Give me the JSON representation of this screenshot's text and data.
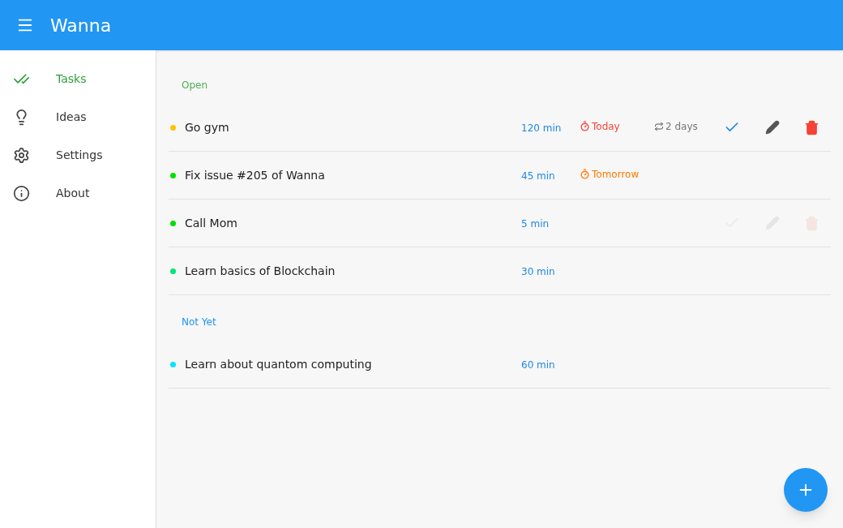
{
  "app_bar": {
    "title": "Wanna"
  },
  "sidebar": {
    "items": [
      {
        "label": "Tasks",
        "selected": true
      },
      {
        "label": "Ideas",
        "selected": false
      },
      {
        "label": "Settings",
        "selected": false
      },
      {
        "label": "About",
        "selected": false
      }
    ]
  },
  "sections": [
    {
      "title": "Open",
      "color": "#4caf50",
      "tasks": [
        {
          "title": "Go gym",
          "color": "#ffc107",
          "duration": "120 min",
          "due": {
            "label": "Today",
            "color": "#f44336"
          },
          "repeat": "2 days",
          "actions_visible": true,
          "actions_faded": false
        },
        {
          "title": "Fix issue #205 of Wanna",
          "color": "#00e000",
          "duration": "45 min",
          "due": {
            "label": "Tomorrow",
            "color": "#ff7a00"
          },
          "actions_visible": false,
          "actions_faded": false
        },
        {
          "title": "Call Mom",
          "color": "#00e000",
          "duration": "5 min",
          "actions_visible": true,
          "actions_faded": true
        },
        {
          "title": "Learn basics of Blockchain",
          "color": "#00e676",
          "duration": "30 min",
          "actions_visible": false,
          "actions_faded": false
        }
      ]
    },
    {
      "title": "Not Yet",
      "color": "#2196f3",
      "tasks": [
        {
          "title": "Learn about quantom computing",
          "color": "#00e5ff",
          "duration": "60 min",
          "actions_visible": false,
          "actions_faded": false
        }
      ]
    }
  ]
}
